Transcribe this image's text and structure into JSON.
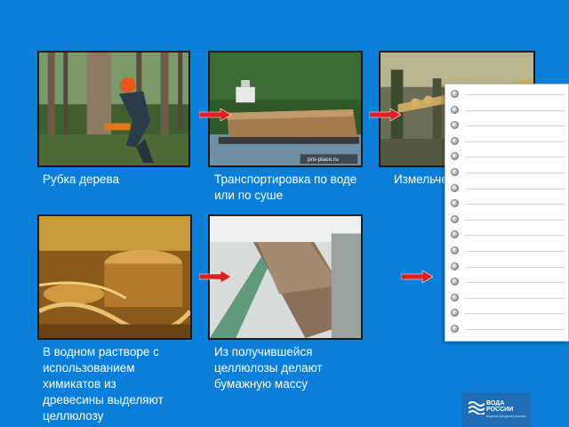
{
  "steps": {
    "step1": {
      "caption": "Рубка дерева"
    },
    "step2": {
      "caption": "Транспортировка по воде или по суше",
      "watermark": "pro-place.ru"
    },
    "step3": {
      "caption": "Измельчение в стружку"
    },
    "step4": {
      "caption": "В водном растворе с использованием химикатов из древесины выделяют целлюлозу"
    },
    "step5": {
      "caption": "Из получившейся целлюлозы делают бумажную массу"
    }
  },
  "logo": {
    "line1": "ВОДА",
    "line2": "РОССИИ",
    "tagline": "водные ресурсы россии"
  },
  "icons": {
    "arrow": "red-arrow-right-icon",
    "notepad": "spiral-notepad-icon",
    "logo": "waves-logo-icon"
  },
  "colors": {
    "background": "#0a7fd9",
    "arrow": "#e02020",
    "caption_text": "#ffffff",
    "logo_bg": "#1e6db5"
  }
}
